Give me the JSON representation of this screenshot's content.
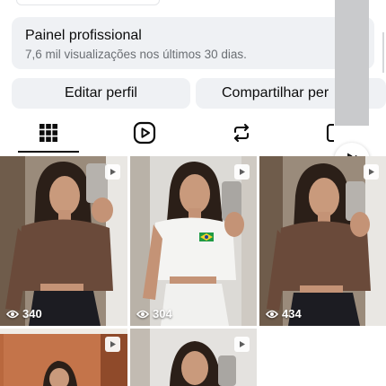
{
  "panel": {
    "title": "Painel profissional",
    "subtitle": "7,6 mil visualizações nos últimos 30 dias."
  },
  "actions": {
    "edit_profile": "Editar perfil",
    "share_profile": "Compartilhar per"
  },
  "tabs": [
    {
      "name": "grid",
      "icon": "grid-icon",
      "selected": true
    },
    {
      "name": "reels",
      "icon": "reels-icon",
      "selected": false
    },
    {
      "name": "reposts",
      "icon": "repost-icon",
      "selected": false
    },
    {
      "name": "tagged",
      "icon": "tagged-icon",
      "selected": false
    }
  ],
  "posts": [
    {
      "views": "340",
      "type": "reel",
      "outfit": "brown long-sleeve crop top, black skirt"
    },
    {
      "views": "304",
      "type": "reel",
      "outfit": "white t-shirt with Brazil flag, white skirt"
    },
    {
      "views": "434",
      "type": "reel",
      "outfit": "brown long-sleeve crop top, black skirt"
    },
    {
      "views": "",
      "type": "reel"
    },
    {
      "views": "",
      "type": "reel"
    }
  ],
  "colors": {
    "panel_bg": "#eff1f4",
    "text_primary": "#0c0c0c",
    "text_secondary": "#6b6f74"
  }
}
